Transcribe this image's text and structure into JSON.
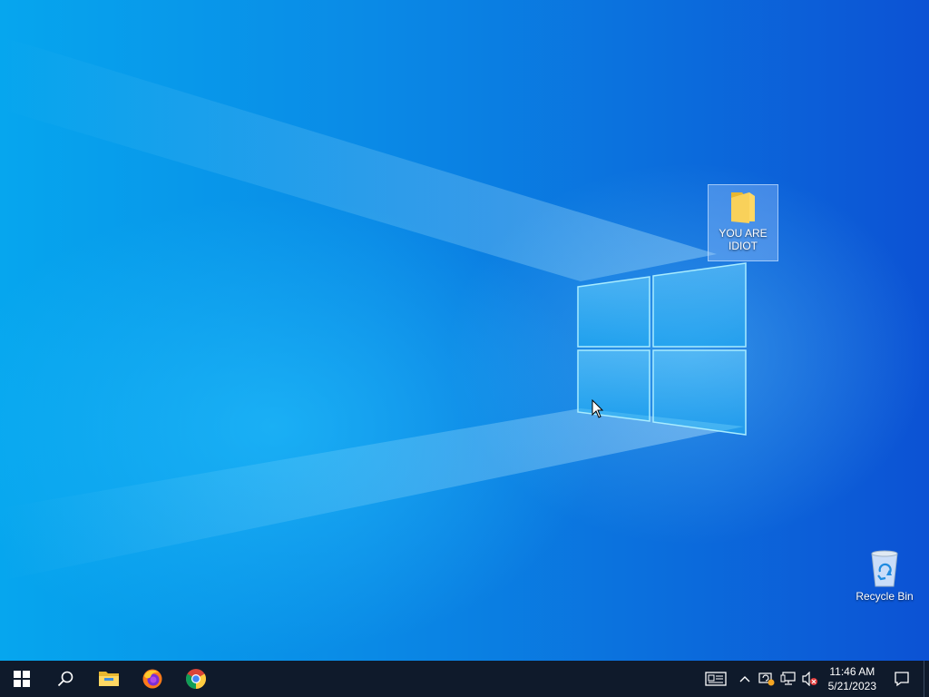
{
  "desktop": {
    "icons": [
      {
        "label": "YOU ARE IDIOT",
        "icon": "folder-icon",
        "selected": true
      },
      {
        "label": "Recycle Bin",
        "icon": "recycle-bin-icon",
        "selected": false
      }
    ]
  },
  "taskbar": {
    "pinned": [
      {
        "name": "start-icon"
      },
      {
        "name": "search-icon"
      },
      {
        "name": "file-explorer-icon"
      },
      {
        "name": "firefox-icon"
      },
      {
        "name": "chrome-icon"
      }
    ],
    "tray": {
      "icons": [
        "news-icon",
        "chevron-up-icon",
        "update-icon",
        "network-icon",
        "volume-muted-icon",
        "notification-icon"
      ],
      "time": "11:46 AM",
      "date": "5/21/2023"
    }
  },
  "colors": {
    "taskbar": "#0f1a2b",
    "accent": "#0a8ae6"
  }
}
